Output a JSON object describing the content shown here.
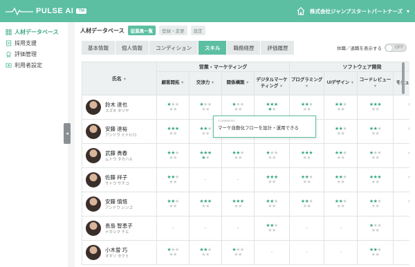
{
  "brand": {
    "name": "PULSE AI",
    "badge": "TM"
  },
  "header": {
    "company": "株式会社ジャンプスタートパートナーズ"
  },
  "sidebar": {
    "items": [
      {
        "label": "人材データベース",
        "icon": "people-icon",
        "active": true
      },
      {
        "label": "採用支援",
        "icon": "document-icon",
        "active": false
      },
      {
        "label": "評価管理",
        "icon": "badge-icon",
        "active": false
      },
      {
        "label": "利用者設定",
        "icon": "user-settings-icon",
        "active": false
      }
    ]
  },
  "page": {
    "title": "人材データベース",
    "view_pills": [
      {
        "label": "従業員一覧",
        "active": true
      },
      {
        "label": "登録・変更",
        "active": false
      },
      {
        "label": "設定",
        "active": false
      }
    ]
  },
  "tabs": [
    {
      "label": "基本情報",
      "active": false
    },
    {
      "label": "個人情報",
      "active": false
    },
    {
      "label": "コンディション",
      "active": false
    },
    {
      "label": "スキル",
      "active": true
    },
    {
      "label": "職務経歴",
      "active": false
    },
    {
      "label": "評価履歴",
      "active": false
    }
  ],
  "retired_toggle": {
    "label": "休職／退職を表示する",
    "state": "OFF"
  },
  "table": {
    "name_header": "氏名",
    "groups": [
      {
        "label": "営業・マーケティング",
        "span": 4
      },
      {
        "label": "ソフトウェア開発",
        "span": 4
      }
    ],
    "columns": [
      "顧客開拓",
      "交渉力",
      "関係構築",
      "デジタルマーケティング",
      "プログラミング",
      "UIデザイン",
      "コードレビュー",
      "モジュール設計"
    ],
    "rows": [
      {
        "name": "鈴木 達也",
        "kana": "スズキ タツヤ",
        "skills": [
          [
            1,
            0
          ],
          [
            1,
            0
          ],
          [
            1,
            0
          ],
          [
            3,
            1
          ],
          [
            2,
            0
          ],
          [
            2,
            0
          ],
          [
            3,
            0
          ],
          [
            1,
            0
          ]
        ]
      },
      {
        "name": "安藤 達裕",
        "kana": "アンドウ ミナヒロ",
        "skills": [
          [
            3,
            0
          ],
          [
            2,
            0
          ],
          [
            null,
            null
          ],
          [
            null,
            null
          ],
          [
            2,
            0
          ],
          [
            2,
            0
          ],
          [
            2,
            0
          ],
          [
            1,
            0
          ]
        ]
      },
      {
        "name": "武藤 貴春",
        "kana": "ムトウ タカハル",
        "skills": [
          [
            2,
            0
          ],
          [
            3,
            1
          ],
          [
            2,
            0
          ],
          [
            1,
            0
          ],
          [
            3,
            0
          ],
          [
            2,
            0
          ],
          [
            1,
            0
          ],
          [
            1,
            0
          ]
        ]
      },
      {
        "name": "佐藤 祥子",
        "kana": "サトウ サチコ",
        "skills": [
          [
            2,
            0
          ],
          [
            "-"
          ],
          [
            "-"
          ],
          [
            3,
            0
          ],
          [
            2,
            0
          ],
          [
            2,
            0
          ],
          [
            3,
            0
          ],
          [
            1,
            0
          ]
        ]
      },
      {
        "name": "安藤 慎悟",
        "kana": "アンドウ シンゴ",
        "skills": [
          [
            2,
            0
          ],
          [
            3,
            0
          ],
          [
            3,
            0
          ],
          [
            2,
            0
          ],
          [
            2,
            0
          ],
          [
            2,
            0
          ],
          [
            2,
            0
          ],
          [
            1,
            0
          ]
        ]
      },
      {
        "name": "長島 智恵子",
        "kana": "ナガシマ チエ",
        "skills": [
          [
            "-"
          ],
          [
            "-"
          ],
          [
            "-"
          ],
          [
            2,
            0
          ],
          [
            "-"
          ],
          [
            "-"
          ],
          [
            1,
            0
          ],
          [
            "-"
          ]
        ]
      },
      {
        "name": "小木曽 巧",
        "kana": "オギソ タクミ",
        "skills": [
          [
            1,
            0
          ],
          [
            2,
            0
          ],
          [
            1,
            0
          ],
          [
            "-"
          ],
          [
            "-"
          ],
          [
            "-"
          ],
          [
            2,
            0
          ],
          [
            "-"
          ]
        ]
      }
    ]
  },
  "tooltip": {
    "label": "COMMENT",
    "text": "マーケ自動化フローを設計・運用できる"
  },
  "colors": {
    "accent": "#5cbfa2",
    "star_on": "#3aa585",
    "star_off": "#c9cccc"
  }
}
